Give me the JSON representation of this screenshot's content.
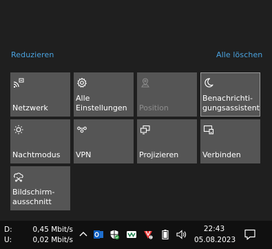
{
  "action_center": {
    "collapse_label": "Reduzieren",
    "clear_all_label": "Alle löschen",
    "tiles": [
      {
        "label": "Netzwerk",
        "icon": "network-icon",
        "state": "normal"
      },
      {
        "label": "Alle Einstellungen",
        "icon": "gear-icon",
        "state": "normal"
      },
      {
        "label": "Position",
        "icon": "location-icon",
        "state": "disabled"
      },
      {
        "label": "Benachrichti-gungsassistent",
        "icon": "moon-icon",
        "state": "active"
      },
      {
        "label": "Nachtmodus",
        "icon": "brightness-icon",
        "state": "normal"
      },
      {
        "label": "VPN",
        "icon": "vpn-icon",
        "state": "normal"
      },
      {
        "label": "Projizieren",
        "icon": "project-icon",
        "state": "normal"
      },
      {
        "label": "Verbinden",
        "icon": "connect-icon",
        "state": "normal"
      },
      {
        "label": "Bildschirm-ausschnitt",
        "icon": "snip-icon",
        "state": "normal"
      }
    ]
  },
  "taskbar": {
    "network_speed": {
      "download_label": "D:",
      "upload_label": "U:",
      "download_value": "0,45 Mbit/s",
      "upload_value": "0,02 Mbit/s"
    },
    "tray_icons": [
      "chevron-up-icon",
      "outlook-icon",
      "security-icon",
      "veeam-icon",
      "vivaldi-icon",
      "battery-icon",
      "speaker-icon"
    ],
    "time": "22:43",
    "date": "05.08.2023"
  },
  "colors": {
    "link": "#4aa3e0",
    "tile_bg": "#555555",
    "panel_bg": "#1f1f1f",
    "taskbar_bg": "#101010"
  }
}
